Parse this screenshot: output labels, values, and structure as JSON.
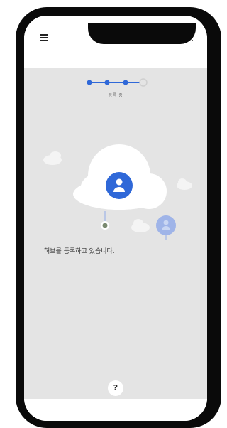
{
  "app": {
    "header": {
      "menu_icon": "hamburger-menu-icon",
      "apps_icon": "grid-apps-icon"
    },
    "progress": {
      "total_steps": 4,
      "completed_steps": 3,
      "caption": "등록 중"
    },
    "illustration": {
      "cloud_icon": "cloud-icon",
      "user_icon": "person-icon",
      "hub_icon": "hub-device-icon"
    },
    "status_message": "허브를 등록하고 있습니다.",
    "help": {
      "label": "?"
    },
    "colors": {
      "accent": "#2f68d8",
      "accent_faded": "#9fb4e8",
      "background": "#e4e4e4",
      "hub": "#7a8a70"
    }
  }
}
